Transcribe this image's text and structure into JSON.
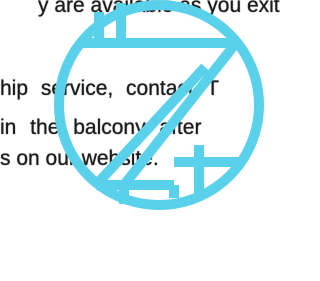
{
  "text_lines": [
    "y are available as you exit",
    "hip service, contact T",
    "in the balcony after",
    "s on our website."
  ],
  "logo": {
    "name": "z-circle-logo",
    "color": "#5ad1ea",
    "background": "#ffffff"
  }
}
